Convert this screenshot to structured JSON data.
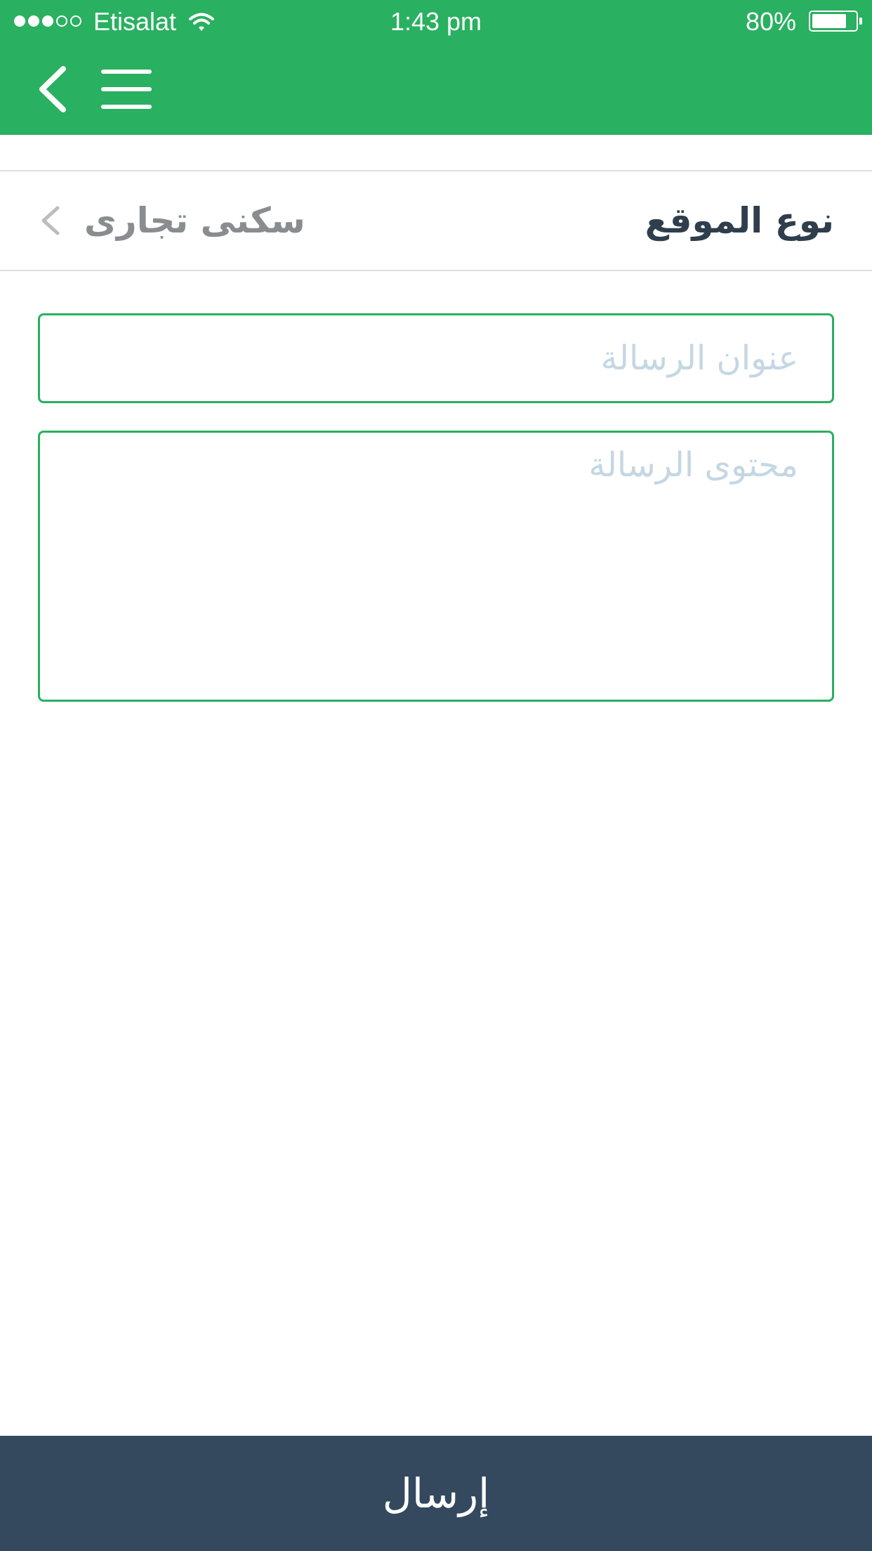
{
  "status_bar": {
    "carrier": "Etisalat",
    "time": "1:43 pm",
    "battery_percent_label": "80%",
    "battery_level": 0.8,
    "signal_bars_filled": 3,
    "signal_bars_total": 5
  },
  "nav": {
    "back_icon": "chevron-left-icon",
    "menu_icon": "hamburger-menu-icon",
    "background_color": "#29b060"
  },
  "location": {
    "label": "نوع الموقع",
    "value": "سكنى تجارى",
    "chevron_icon": "chevron-left-icon"
  },
  "form": {
    "title_placeholder": "عنوان الرسالة",
    "title_value": "",
    "body_placeholder": "محتوى الرسالة",
    "body_value": "",
    "border_color": "#29b060"
  },
  "submit": {
    "label": "إرسال",
    "background_color": "#34495e"
  }
}
